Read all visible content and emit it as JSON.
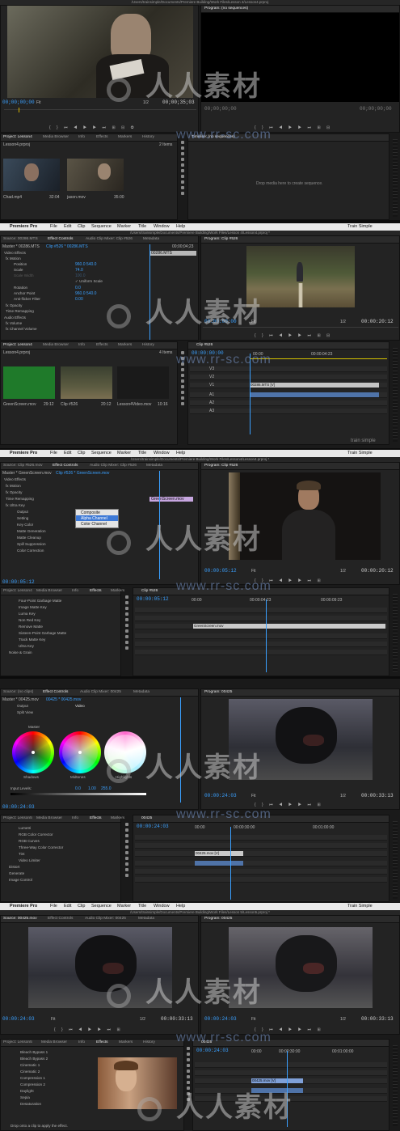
{
  "app": {
    "name": "Premiere Pro",
    "menus": [
      "File",
      "Edit",
      "Clip",
      "Sequence",
      "Marker",
      "Title",
      "Window",
      "Help"
    ],
    "workspace": "Train Simple",
    "brand_mark": "train simple"
  },
  "watermark": {
    "text_cn": "人人素材",
    "url": "www.rr-sc.com"
  },
  "shot1": {
    "source_title": "Source: jason.mov",
    "source_tabs": [
      "Effect Controls",
      "Audio Clip Mixer: (no clips)",
      "Metadata"
    ],
    "source_timecode": "00;00;00;00",
    "source_fit": "Fit",
    "source_ratio": "1/2",
    "source_duration": "00;00;35;03",
    "program_title": "Program: (no sequences)",
    "program_tc_left": "00;00;00;00",
    "program_tc_right": "00;00;00;00",
    "project_title": "Project: Lesson4",
    "project_tabs": [
      "Media Browser",
      "Info",
      "Effects",
      "Markers",
      "History"
    ],
    "project_file": "Lesson4.prproj",
    "item_count": "2 Items",
    "items": [
      {
        "name": "Chad.mp4",
        "duration": "32:04"
      },
      {
        "name": "jason.mov",
        "duration": "35:00"
      }
    ],
    "timeline_title": "Timeline: (no sequences)",
    "timeline_message": "Drop media here to create sequence."
  },
  "shot2": {
    "path": "/Users/trainsimple/Documents/Premiere Building/Work Files/Lesson 4/Lesson4.prproj *",
    "source_title": "Source: 00286.MTS",
    "tabs": [
      "Effect Controls",
      "Audio Clip Mixer: Clip #526",
      "Metadata"
    ],
    "master": "Master * 00286.MTS",
    "clip_path": "Clip #526 * 00286.MTS",
    "ec_timecode_mini": "00;00;04;23",
    "ec_clip": "00286.MTS",
    "rows": [
      {
        "label": "Video Effects",
        "value": ""
      },
      {
        "label": "fx Motion",
        "value": ""
      },
      {
        "label": "Position",
        "value": "960.0   540.0"
      },
      {
        "label": "Scale",
        "value": "74.0"
      },
      {
        "label": "Scale Width",
        "value": "100.0"
      },
      {
        "label": "",
        "value": "✓ Uniform Scale"
      },
      {
        "label": "Rotation",
        "value": "0.0"
      },
      {
        "label": "Anchor Point",
        "value": "960.0   540.0"
      },
      {
        "label": "Anti-flicker Filter",
        "value": "0.00"
      },
      {
        "label": "fx Opacity",
        "value": ""
      },
      {
        "label": "Time Remapping",
        "value": ""
      },
      {
        "label": "Audio Effects",
        "value": ""
      },
      {
        "label": "fx Volume",
        "value": ""
      },
      {
        "label": "fx Channel Volume",
        "value": ""
      }
    ],
    "program_title": "Program: Clip #526",
    "program_tc": "00:00:00:00",
    "program_fit": "Fit",
    "program_ratio": "1/2",
    "program_duration": "00:00:20:12",
    "project_title": "Project: Lesson4",
    "project_tabs": [
      "Media Browser",
      "Info",
      "Effects",
      "Markers",
      "History"
    ],
    "project_file": "Lesson4.prproj",
    "item_count": "4 Items",
    "items": [
      {
        "name": "GreenScreen.mov",
        "duration": "29:12"
      },
      {
        "name": "Clip #526",
        "duration": "20:12"
      },
      {
        "name": "Lesson4Video.mov",
        "duration": "10:16"
      }
    ],
    "timeline_title": "Clip #526",
    "timeline_tc": "00:00:00:00",
    "ruler": [
      "00:00",
      "00:00:04:23"
    ],
    "tracks": [
      "V3",
      "V2",
      "V1",
      "A1",
      "A2",
      "A3"
    ],
    "clip_v": "00286.MTS [V]"
  },
  "shot3": {
    "path": "/Users/trainsimple/Documents/Premiere Building/Work Files/Lesson4/Lesson4.prproj *",
    "source_title": "Source: Clip #526.mov",
    "tabs": [
      "Effect Controls",
      "Audio Clip Mixer: Clip #526",
      "Metadata"
    ],
    "master": "Master * GreenScreen.mov",
    "clip_path": "Clip #526 * GreenScreen.mov",
    "ec_clip": "GreenScreen.mov",
    "rows": [
      "Video Effects",
      "fx Motion",
      "fx Opacity",
      "Time Remapping",
      "fx Ultra Key",
      "Output",
      "Setting",
      "Key Color",
      "Matte Generation",
      "Matte Cleanup",
      "Spill Suppression",
      "Color Correction"
    ],
    "dropdown": [
      "Composite",
      "Alpha Channel",
      "Color Channel"
    ],
    "dropdown_selected": "Composite",
    "ec_timecode": "00:00:05:12",
    "program_title": "Program: Clip #526",
    "program_tc": "00:00:05:12",
    "program_fit": "Fit",
    "program_ratio": "1/2",
    "program_duration": "00:00:20:12",
    "effects_tabs": [
      "Project: Lesson4",
      "Media Browser",
      "Info",
      "Effects",
      "Markers"
    ],
    "effects_list": [
      "Four-Point Garbage Matte",
      "Image Matte Key",
      "Luma Key",
      "Non Red Key",
      "Remove Matte",
      "Sixteen-Point Garbage Matte",
      "Track Matte Key",
      "Ultra Key",
      "Noise & Grain"
    ],
    "timeline_title": "Clip #526",
    "timeline_tc": "00:00:05:12",
    "ruler": [
      "00:00",
      "00:00:04:23",
      "00:00:09:23"
    ],
    "clip_v": "GreenScreen.mov"
  },
  "shot4": {
    "source_title": "Source: (no clips)",
    "tabs": [
      "Effect Controls",
      "Audio Clip Mixer: 00425",
      "Metadata"
    ],
    "master": "Master * 00425.mov",
    "clip_path": "00425 * 00425.mov",
    "rows": [
      "Output",
      "Split View"
    ],
    "output_value": "Video",
    "wheel_title": "Master",
    "wheels": [
      "Shadows",
      "Midtones",
      "Highlights"
    ],
    "input_levels": "Input Levels:",
    "input_values": [
      "0.0",
      "1.00",
      "255.0"
    ],
    "ec_timecode": "00:00:24:03",
    "program_title": "Program: 00425",
    "program_tc": "00:00:24:03",
    "program_fit": "Fit",
    "program_ratio": "1/2",
    "program_duration": "00:00:33:13",
    "effects_tabs": [
      "Project: Lesson5",
      "Media Browser",
      "Info",
      "Effects",
      "Markers"
    ],
    "effects_list": [
      "Lumetri",
      "RGB Color Corrector",
      "RGB Curves",
      "Three-Way Color Corrector",
      "Tint",
      "Video Limiter",
      "Distort",
      "Generate",
      "Image Control"
    ],
    "timeline_title": "00425",
    "timeline_tc": "00:00:24:03",
    "ruler": [
      "00:00",
      "00:00:30:00",
      "00:01:00:00"
    ],
    "clip_v": "00425.mov [V]"
  },
  "shot5": {
    "path": "/Users/trainsimple/Documents/Premiere Building/Work Files/Lesson 5/Lesson5.prproj *",
    "source_title": "Source: 00425.mov",
    "tabs": [
      "Effect Controls",
      "Audio Clip Mixer: 00425",
      "Metadata"
    ],
    "source_tc": "00:00:24:03",
    "source_fit": "Fit",
    "source_ratio": "1/2",
    "source_duration": "00:00:33:13",
    "program_title": "Program: 00425",
    "program_tc": "00:00:24:03",
    "program_fit": "Fit",
    "program_ratio": "1/2",
    "program_duration": "00:00:33:13",
    "effects_tabs": [
      "Project: Lesson5",
      "Media Browser",
      "Info",
      "Effects",
      "Markers",
      "History"
    ],
    "effects_list": [
      "Bleach Bypass 1",
      "Bleach Bypass 2",
      "Cinematic 1",
      "Cinematic 2",
      "Compression 1",
      "Compression 2",
      "Daylight",
      "Sepia",
      "Desaturation"
    ],
    "status": "Drop onto a clip to apply the effect.",
    "timeline_title": "00425",
    "timeline_tc": "00:00:24:03",
    "ruler": [
      "00:00",
      "00:00:30:00",
      "00:01:00:00"
    ],
    "clip_v": "00425.mov [V]"
  }
}
